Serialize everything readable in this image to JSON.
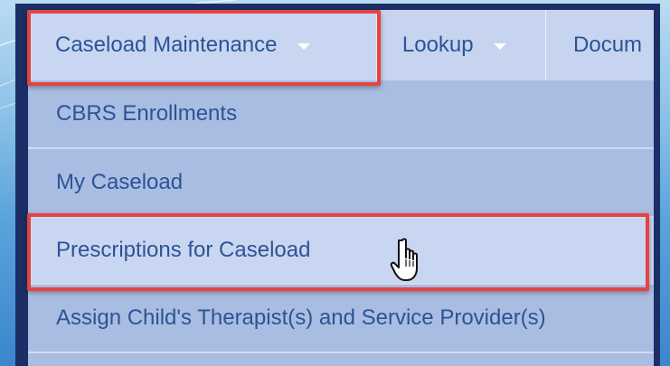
{
  "nav": {
    "items": [
      {
        "label": "Caseload Maintenance",
        "has_caret": true
      },
      {
        "label": "Lookup",
        "has_caret": true
      },
      {
        "label": "Docum",
        "has_caret": false
      }
    ]
  },
  "dropdown": {
    "items": [
      {
        "label": "CBRS Enrollments"
      },
      {
        "label": "My Caseload"
      },
      {
        "label": "Prescriptions for Caseload"
      },
      {
        "label": "Assign Child's Therapist(s) and Service Provider(s)"
      },
      {
        "label": ""
      }
    ]
  },
  "colors": {
    "nav_bg": "#c6d4f0",
    "dropdown_bg": "#a9bde3",
    "text": "#2d5394",
    "highlight_border": "#e5433f",
    "frame": "#1b2f66"
  },
  "icons": {
    "caret": "caret-down-icon",
    "cursor": "hand-pointer-icon"
  }
}
